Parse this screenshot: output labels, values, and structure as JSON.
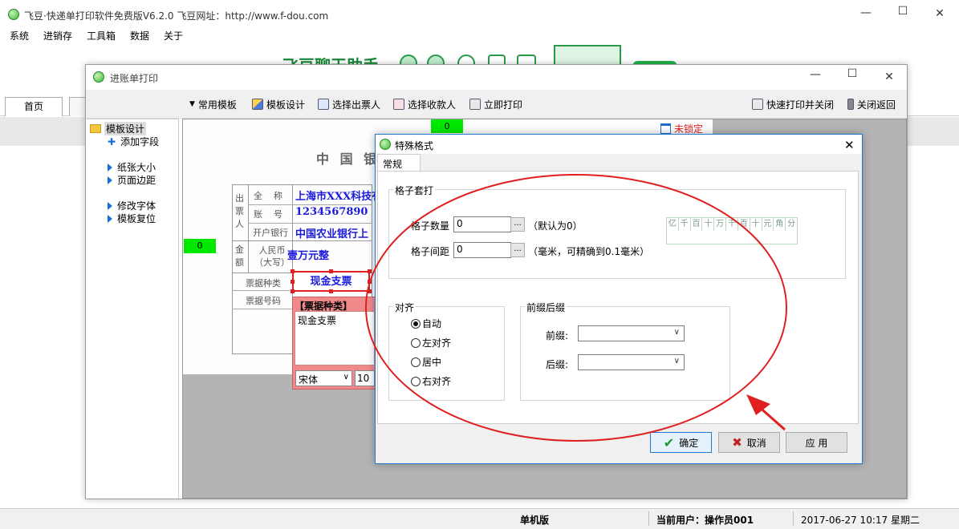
{
  "app": {
    "title": "飞豆·快递单打印软件免费版V6.2.0  飞豆网址：http://www.f-dou.com",
    "menu": [
      "系统",
      "进销存",
      "工具箱",
      "数据",
      "关于"
    ],
    "tab_home": "首页",
    "banner_text": "飞豆聊天助手"
  },
  "inner": {
    "title": "进账单打印",
    "toolbar": {
      "common_templates": "常用模板",
      "template_design": "模板设计",
      "select_issuer": "选择出票人",
      "select_payee": "选择收款人",
      "print_now": "立即打印",
      "quick_print_close": "快速打印并关闭",
      "close_return": "关闭返回"
    },
    "tree": {
      "root": "模板设计",
      "items": [
        "添加字段",
        "纸张大小",
        "页面边距",
        "修改字体",
        "模板复位"
      ]
    },
    "canvas": {
      "ruler_top": "0",
      "ruler_left": "0",
      "lock_status": "未锁定",
      "bank_header": "中 国 银",
      "label_issuer": "出\n票\n人",
      "label_fullname": "全    称",
      "label_account": "账    号",
      "label_bank": "开户银行",
      "value_fullname": "上海市XXX科技有",
      "value_account": "1234567890",
      "value_bank": "中国农业银行上",
      "label_amount": "金\n额",
      "label_rmb": "人民币\n（大写）",
      "value_amount": "壹万元整",
      "label_bill_type": "票据种类",
      "value_bill_type": "现金支票",
      "label_bill_no": "票据号码",
      "editor_title": "【票据种类】",
      "editor_content": "现金支票",
      "editor_font": "宋体",
      "editor_size": "10"
    }
  },
  "dialog": {
    "title": "特殊格式",
    "tab": "常规",
    "grid_group": "格子套打",
    "grid_count_label": "格子数量",
    "grid_count_value": "0",
    "grid_count_hint": "（默认为0）",
    "grid_spacing_label": "格子间距",
    "grid_spacing_value": "0",
    "grid_spacing_hint": "（毫米，可精确到0.1毫米）",
    "ellipsis": "...",
    "grid_sample": [
      "亿",
      "千",
      "百",
      "十",
      "万",
      "千",
      "百",
      "十",
      "元",
      "角",
      "分"
    ],
    "align_group": "对齐",
    "align_options": [
      "自动",
      "左对齐",
      "居中",
      "右对齐"
    ],
    "align_selected": 0,
    "affix_group": "前缀后缀",
    "prefix_label": "前缀:",
    "suffix_label": "后缀:",
    "prefix_value": "",
    "suffix_value": "",
    "ok": "确定",
    "cancel": "取消",
    "apply": "应 用"
  },
  "status": {
    "mode": "单机版",
    "user": "当前用户：操作员001",
    "datetime": "2017-06-27 10:17 星期二"
  },
  "colors": {
    "annotation_red": "#e02020",
    "highlight_green": "#00e800",
    "field_blue": "#1a1adb"
  }
}
